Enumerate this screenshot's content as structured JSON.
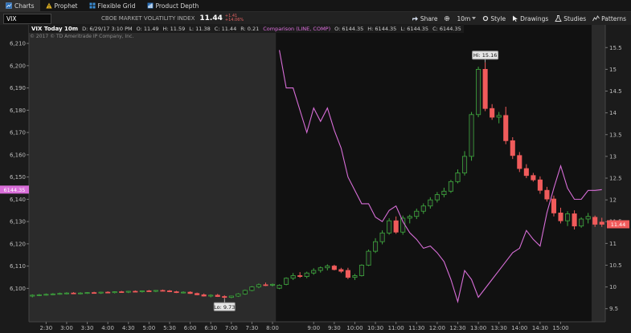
{
  "tabs": [
    {
      "label": "Charts",
      "icon": "chart-icon",
      "active": true
    },
    {
      "label": "Prophet",
      "icon": "warning-icon",
      "active": false
    },
    {
      "label": "Flexible Grid",
      "icon": "grid-icon",
      "active": false
    },
    {
      "label": "Product Depth",
      "icon": "depth-icon",
      "active": false
    }
  ],
  "toolbar": {
    "symbol": "VIX",
    "description": "CBOE MARKET VOLATILITY INDEX",
    "last": "11.44",
    "change": "+1.41",
    "change_pct": "+14.06%",
    "share": "Share",
    "timeframe": "10m",
    "style": "Style",
    "drawings": "Drawings",
    "studies": "Studies",
    "patterns": "Patterns"
  },
  "info_bar": {
    "title": "VIX Today 10m",
    "date": "D: 6/29/17 3:10 PM",
    "open": "O: 11.49",
    "high": "H: 11.59",
    "low": "L: 11.38",
    "close": "C: 11.44",
    "range": "R: 0.21",
    "comparison": "Comparison (LINE, COMP)",
    "cmp_open": "O: 6144.35",
    "cmp_high": "H: 6144.35",
    "cmp_low": "L: 6144.35",
    "cmp_close": "C: 6144.35"
  },
  "copyright": "© 2017 © TD Ameritrade IP Company, Inc.",
  "colors": {
    "up": "#3faa3f",
    "down": "#f05b5b",
    "comparison": "#d86ed8",
    "premarket": "#2b2b2b",
    "plot": "#111111"
  },
  "chart_data": {
    "type": "candlestick",
    "x_tick_labels": [
      "2:30",
      "3:00",
      "3:30",
      "4:00",
      "4:30",
      "5:00",
      "5:30",
      "6:00",
      "6:30",
      "7:00",
      "7:30",
      "8:00",
      "9:00",
      "9:30",
      "10:00",
      "10:30",
      "11:00",
      "11:30",
      "12:00",
      "12:30",
      "13:00",
      "13:30",
      "14:00",
      "14:30",
      "15:00"
    ],
    "left_axis": {
      "label": "Comparison",
      "range": [
        6085,
        6214
      ],
      "ticks": [
        6100,
        6110,
        6120,
        6130,
        6140,
        6150,
        6160,
        6170,
        6180,
        6190,
        6200,
        6210
      ]
    },
    "right_axis": {
      "label": "VIX",
      "range": [
        9.2,
        15.8
      ],
      "ticks": [
        9.5,
        10,
        10.5,
        11,
        11.5,
        12,
        12.5,
        13,
        13.5,
        14,
        14.5,
        15,
        15.5
      ]
    },
    "high_marker": "Hi: 15.16",
    "low_marker": "Lo: 9.73",
    "current_left_label": "6144.35",
    "current_right_label": "11.44",
    "candles": [
      {
        "t": "2:05",
        "o": 9.79,
        "h": 9.83,
        "l": 9.76,
        "c": 9.81
      },
      {
        "t": "2:15",
        "o": 9.81,
        "h": 9.84,
        "l": 9.79,
        "c": 9.82
      },
      {
        "t": "2:25",
        "o": 9.82,
        "h": 9.85,
        "l": 9.8,
        "c": 9.83
      },
      {
        "t": "2:35",
        "o": 9.83,
        "h": 9.86,
        "l": 9.81,
        "c": 9.84
      },
      {
        "t": "2:45",
        "o": 9.84,
        "h": 9.87,
        "l": 9.82,
        "c": 9.85
      },
      {
        "t": "2:55",
        "o": 9.85,
        "h": 9.88,
        "l": 9.83,
        "c": 9.86
      },
      {
        "t": "3:05",
        "o": 9.86,
        "h": 9.88,
        "l": 9.84,
        "c": 9.85
      },
      {
        "t": "3:15",
        "o": 9.85,
        "h": 9.88,
        "l": 9.83,
        "c": 9.86
      },
      {
        "t": "3:25",
        "o": 9.86,
        "h": 9.88,
        "l": 9.84,
        "c": 9.87
      },
      {
        "t": "3:35",
        "o": 9.87,
        "h": 9.89,
        "l": 9.85,
        "c": 9.86
      },
      {
        "t": "3:45",
        "o": 9.86,
        "h": 9.89,
        "l": 9.84,
        "c": 9.88
      },
      {
        "t": "3:55",
        "o": 9.88,
        "h": 9.9,
        "l": 9.86,
        "c": 9.87
      },
      {
        "t": "4:05",
        "o": 9.87,
        "h": 9.9,
        "l": 9.85,
        "c": 9.89
      },
      {
        "t": "4:15",
        "o": 9.89,
        "h": 9.91,
        "l": 9.87,
        "c": 9.88
      },
      {
        "t": "4:25",
        "o": 9.88,
        "h": 9.91,
        "l": 9.86,
        "c": 9.9
      },
      {
        "t": "4:35",
        "o": 9.9,
        "h": 9.92,
        "l": 9.88,
        "c": 9.89
      },
      {
        "t": "4:45",
        "o": 9.89,
        "h": 9.92,
        "l": 9.87,
        "c": 9.91
      },
      {
        "t": "4:55",
        "o": 9.91,
        "h": 9.93,
        "l": 9.89,
        "c": 9.9
      },
      {
        "t": "5:05",
        "o": 9.9,
        "h": 9.93,
        "l": 9.88,
        "c": 9.92
      },
      {
        "t": "5:15",
        "o": 9.92,
        "h": 9.94,
        "l": 9.9,
        "c": 9.91
      },
      {
        "t": "5:25",
        "o": 9.91,
        "h": 9.93,
        "l": 9.88,
        "c": 9.89
      },
      {
        "t": "5:35",
        "o": 9.89,
        "h": 9.91,
        "l": 9.86,
        "c": 9.87
      },
      {
        "t": "5:45",
        "o": 9.87,
        "h": 9.9,
        "l": 9.85,
        "c": 9.88
      },
      {
        "t": "5:55",
        "o": 9.88,
        "h": 9.9,
        "l": 9.84,
        "c": 9.85
      },
      {
        "t": "6:05",
        "o": 9.85,
        "h": 9.87,
        "l": 9.81,
        "c": 9.82
      },
      {
        "t": "6:15",
        "o": 9.82,
        "h": 9.85,
        "l": 9.78,
        "c": 9.79
      },
      {
        "t": "6:25",
        "o": 9.79,
        "h": 9.83,
        "l": 9.76,
        "c": 9.81
      },
      {
        "t": "6:35",
        "o": 9.81,
        "h": 9.84,
        "l": 9.77,
        "c": 9.78
      },
      {
        "t": "6:45",
        "o": 9.78,
        "h": 9.81,
        "l": 9.73,
        "c": 9.76
      },
      {
        "t": "6:55",
        "o": 9.76,
        "h": 9.8,
        "l": 9.74,
        "c": 9.79
      },
      {
        "t": "7:05",
        "o": 9.79,
        "h": 9.86,
        "l": 9.77,
        "c": 9.84
      },
      {
        "t": "7:15",
        "o": 9.84,
        "h": 9.94,
        "l": 9.82,
        "c": 9.92
      },
      {
        "t": "7:25",
        "o": 9.92,
        "h": 10.02,
        "l": 9.9,
        "c": 10.0
      },
      {
        "t": "7:35",
        "o": 10.0,
        "h": 10.08,
        "l": 9.97,
        "c": 10.05
      },
      {
        "t": "7:45",
        "o": 10.05,
        "h": 10.1,
        "l": 10.02,
        "c": 10.04
      },
      {
        "t": "7:55",
        "o": 10.04,
        "h": 10.08,
        "l": 10.01,
        "c": 10.06
      },
      {
        "t": "8:05",
        "o": 9.97,
        "h": 10.06,
        "l": 9.95,
        "c": 10.04
      },
      {
        "t": "8:15",
        "o": 10.06,
        "h": 10.22,
        "l": 10.04,
        "c": 10.2
      },
      {
        "t": "8:25",
        "o": 10.2,
        "h": 10.32,
        "l": 10.16,
        "c": 10.26
      },
      {
        "t": "8:35",
        "o": 10.26,
        "h": 10.34,
        "l": 10.21,
        "c": 10.24
      },
      {
        "t": "8:45",
        "o": 10.24,
        "h": 10.35,
        "l": 10.2,
        "c": 10.32
      },
      {
        "t": "8:55",
        "o": 10.32,
        "h": 10.43,
        "l": 10.28,
        "c": 10.38
      },
      {
        "t": "9:05",
        "o": 10.38,
        "h": 10.47,
        "l": 10.33,
        "c": 10.44
      },
      {
        "t": "9:15",
        "o": 10.44,
        "h": 10.52,
        "l": 10.38,
        "c": 10.48
      },
      {
        "t": "9:25",
        "o": 10.48,
        "h": 10.51,
        "l": 10.38,
        "c": 10.4
      },
      {
        "t": "9:35",
        "o": 10.4,
        "h": 10.44,
        "l": 10.32,
        "c": 10.36
      },
      {
        "t": "9:45",
        "o": 10.38,
        "h": 10.44,
        "l": 10.18,
        "c": 10.22
      },
      {
        "t": "9:55",
        "o": 10.22,
        "h": 10.3,
        "l": 10.16,
        "c": 10.26
      },
      {
        "t": "10:05",
        "o": 10.26,
        "h": 10.52,
        "l": 10.24,
        "c": 10.5
      },
      {
        "t": "10:15",
        "o": 10.5,
        "h": 10.86,
        "l": 10.48,
        "c": 10.82
      },
      {
        "t": "10:25",
        "o": 10.82,
        "h": 11.12,
        "l": 10.78,
        "c": 11.04
      },
      {
        "t": "10:35",
        "o": 11.04,
        "h": 11.3,
        "l": 10.98,
        "c": 11.24
      },
      {
        "t": "10:45",
        "o": 11.24,
        "h": 11.58,
        "l": 11.2,
        "c": 11.52
      },
      {
        "t": "10:55",
        "o": 11.52,
        "h": 11.62,
        "l": 11.22,
        "c": 11.26
      },
      {
        "t": "11:05",
        "o": 11.26,
        "h": 11.64,
        "l": 11.2,
        "c": 11.58
      },
      {
        "t": "11:15",
        "o": 11.58,
        "h": 11.66,
        "l": 11.46,
        "c": 11.62
      },
      {
        "t": "11:25",
        "o": 11.62,
        "h": 11.8,
        "l": 11.56,
        "c": 11.74
      },
      {
        "t": "11:35",
        "o": 11.74,
        "h": 11.92,
        "l": 11.68,
        "c": 11.86
      },
      {
        "t": "11:45",
        "o": 11.86,
        "h": 12.06,
        "l": 11.8,
        "c": 12.0
      },
      {
        "t": "11:55",
        "o": 12.0,
        "h": 12.18,
        "l": 11.94,
        "c": 12.12
      },
      {
        "t": "12:05",
        "o": 12.12,
        "h": 12.28,
        "l": 12.06,
        "c": 12.2
      },
      {
        "t": "12:15",
        "o": 12.2,
        "h": 12.46,
        "l": 12.16,
        "c": 12.42
      },
      {
        "t": "12:25",
        "o": 12.42,
        "h": 12.7,
        "l": 12.38,
        "c": 12.62
      },
      {
        "t": "12:35",
        "o": 12.62,
        "h": 13.12,
        "l": 12.56,
        "c": 13.0
      },
      {
        "t": "12:45",
        "o": 13.0,
        "h": 14.02,
        "l": 12.9,
        "c": 13.96
      },
      {
        "t": "12:55",
        "o": 13.96,
        "h": 15.06,
        "l": 13.9,
        "c": 15.0
      },
      {
        "t": "13:05",
        "o": 15.0,
        "h": 15.16,
        "l": 14.04,
        "c": 14.1
      },
      {
        "t": "13:15",
        "o": 14.1,
        "h": 14.2,
        "l": 13.84,
        "c": 13.9
      },
      {
        "t": "13:25",
        "o": 13.9,
        "h": 14.02,
        "l": 13.76,
        "c": 13.94
      },
      {
        "t": "13:35",
        "o": 13.94,
        "h": 14.14,
        "l": 13.28,
        "c": 13.36
      },
      {
        "t": "13:45",
        "o": 13.36,
        "h": 13.44,
        "l": 12.94,
        "c": 13.02
      },
      {
        "t": "13:55",
        "o": 13.02,
        "h": 13.1,
        "l": 12.64,
        "c": 12.72
      },
      {
        "t": "14:05",
        "o": 12.72,
        "h": 12.82,
        "l": 12.5,
        "c": 12.56
      },
      {
        "t": "14:15",
        "o": 12.56,
        "h": 12.62,
        "l": 12.42,
        "c": 12.46
      },
      {
        "t": "14:25",
        "o": 12.46,
        "h": 12.54,
        "l": 12.14,
        "c": 12.22
      },
      {
        "t": "14:35",
        "o": 12.22,
        "h": 12.3,
        "l": 11.96,
        "c": 12.02
      },
      {
        "t": "14:45",
        "o": 12.02,
        "h": 12.1,
        "l": 11.62,
        "c": 11.7
      },
      {
        "t": "14:55",
        "o": 11.7,
        "h": 11.82,
        "l": 11.46,
        "c": 11.52
      },
      {
        "t": "15:05",
        "o": 11.52,
        "h": 11.74,
        "l": 11.4,
        "c": 11.68
      },
      {
        "t": "15:15",
        "o": 11.68,
        "h": 11.76,
        "l": 11.32,
        "c": 11.4
      },
      {
        "t": "15:25",
        "o": 11.4,
        "h": 11.6,
        "l": 11.36,
        "c": 11.56
      },
      {
        "t": "15:35",
        "o": 11.56,
        "h": 11.7,
        "l": 11.46,
        "c": 11.62
      },
      {
        "t": "15:45",
        "o": 11.6,
        "h": 11.64,
        "l": 11.38,
        "c": 11.44
      },
      {
        "t": "15:55",
        "o": 11.49,
        "h": 11.59,
        "l": 11.38,
        "c": 11.44
      }
    ],
    "comparison_line": [
      [
        36,
        6207
      ],
      [
        37,
        6190
      ],
      [
        38,
        6190
      ],
      [
        39,
        6180
      ],
      [
        40,
        6170
      ],
      [
        41,
        6181
      ],
      [
        42,
        6175
      ],
      [
        43,
        6181
      ],
      [
        44,
        6171
      ],
      [
        45,
        6163
      ],
      [
        46,
        6150
      ],
      [
        47,
        6144
      ],
      [
        48,
        6138
      ],
      [
        49,
        6138
      ],
      [
        50,
        6132
      ],
      [
        51,
        6130
      ],
      [
        52,
        6135
      ],
      [
        53,
        6137
      ],
      [
        54,
        6130
      ],
      [
        55,
        6125
      ],
      [
        56,
        6122
      ],
      [
        57,
        6118
      ],
      [
        58,
        6119
      ],
      [
        59,
        6116
      ],
      [
        60,
        6112
      ],
      [
        61,
        6104
      ],
      [
        62,
        6094
      ],
      [
        63,
        6108
      ],
      [
        64,
        6104
      ],
      [
        65,
        6096
      ],
      [
        66,
        6100
      ],
      [
        67,
        6104
      ],
      [
        68,
        6108
      ],
      [
        69,
        6112
      ],
      [
        70,
        6116
      ],
      [
        71,
        6118
      ],
      [
        72,
        6126
      ],
      [
        73,
        6122
      ],
      [
        74,
        6119
      ],
      [
        75,
        6134
      ],
      [
        76,
        6145
      ],
      [
        77,
        6155
      ],
      [
        78,
        6145
      ],
      [
        79,
        6140
      ],
      [
        80,
        6140
      ],
      [
        81,
        6144
      ],
      [
        82,
        6144
      ],
      [
        83,
        6144.35
      ]
    ]
  }
}
